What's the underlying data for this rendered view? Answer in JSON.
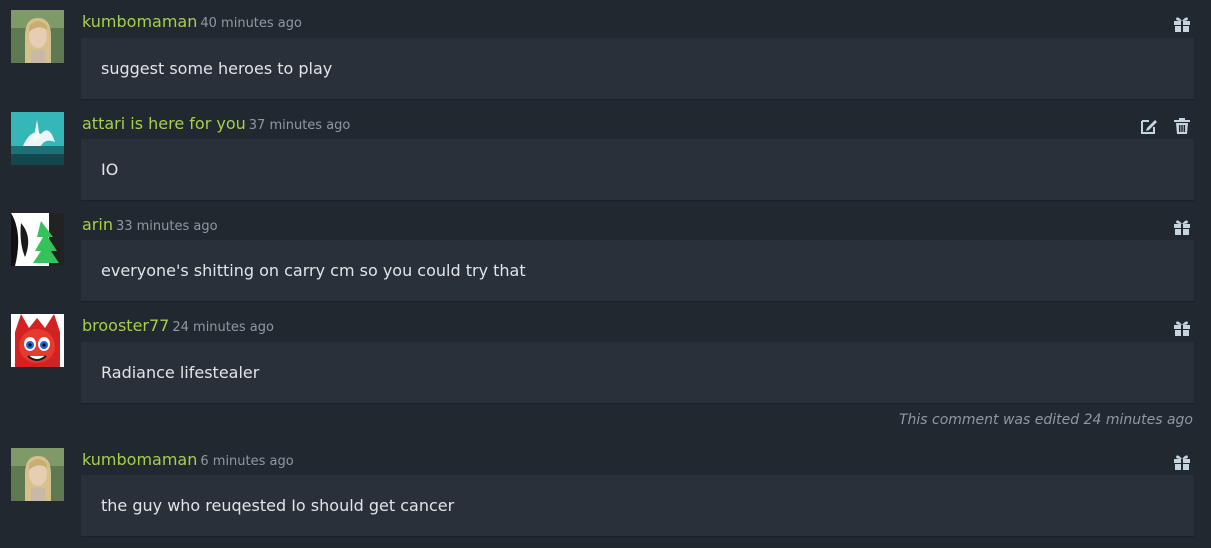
{
  "comments": [
    {
      "author": "kumbomaman",
      "time": "40 minutes ago",
      "text": "suggest some heroes to play",
      "actions": [
        "gift-icon"
      ],
      "edited_note": null
    },
    {
      "author": "attari is here for you",
      "time": "37 minutes ago",
      "text": "IO",
      "actions": [
        "edit-icon",
        "trash-icon"
      ],
      "edited_note": null
    },
    {
      "author": "arin",
      "time": "33 minutes ago",
      "text": "everyone's shitting on carry cm so you could try that",
      "actions": [
        "gift-icon"
      ],
      "edited_note": null
    },
    {
      "author": "brooster77",
      "time": "24 minutes ago",
      "text": "Radiance lifestealer",
      "actions": [
        "gift-icon"
      ],
      "edited_note": "This comment was edited 24 minutes ago"
    },
    {
      "author": "kumbomaman",
      "time": "6 minutes ago",
      "text": "the guy who reuqested Io should get cancer",
      "actions": [
        "gift-icon"
      ],
      "edited_note": null
    }
  ],
  "colors": {
    "background": "#222830",
    "comment_body": "#2a3039",
    "author": "#a4d14b",
    "timestamp": "#8f98a0",
    "body_text": "#e2e4e6",
    "icon": "#c6d4df"
  }
}
